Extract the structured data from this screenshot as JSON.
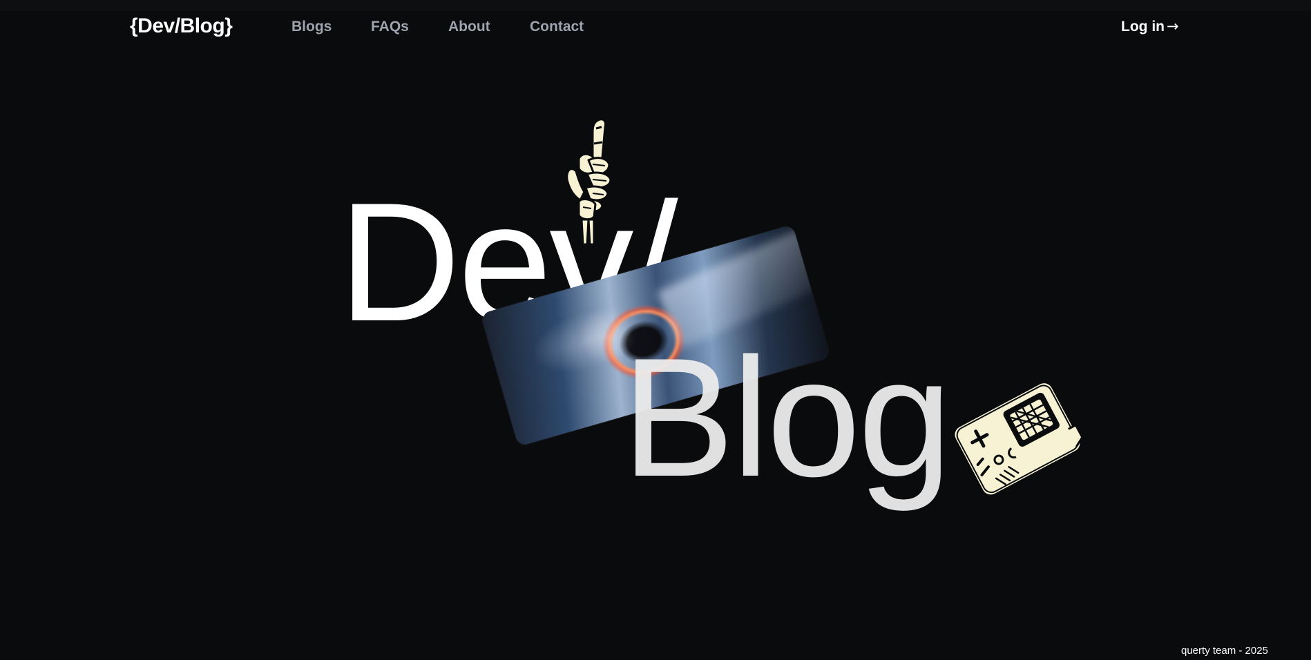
{
  "header": {
    "logo": "{Dev/Blog}",
    "nav": [
      {
        "label": "Blogs"
      },
      {
        "label": "FAQs"
      },
      {
        "label": "About"
      },
      {
        "label": "Contact"
      }
    ],
    "login_label": "Log in",
    "login_arrow": "→"
  },
  "hero": {
    "word_top": "Dev/",
    "word_bottom": "Blog",
    "image_icon": "ring-portal-image",
    "top_illustration": "skeleton-hand-pointing-up",
    "bottom_illustration": "handheld-game-console"
  },
  "footer": {
    "credit": "querty team - 2025"
  },
  "colors": {
    "background": "#0a0b0d",
    "nav_text": "#9fa3ad",
    "primary_text": "#ffffff",
    "illustration": "#f6f2d3"
  }
}
